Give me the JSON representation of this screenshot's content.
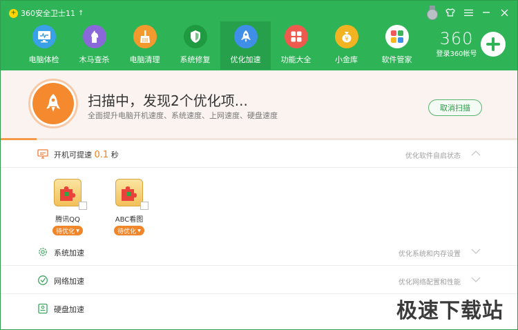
{
  "app": {
    "title": "360安全卫士11"
  },
  "nav": [
    {
      "label": "电脑体检",
      "icon": "monitor-icon",
      "color": "#3aa0e8"
    },
    {
      "label": "木马查杀",
      "icon": "horse-icon",
      "color": "#8b68d9"
    },
    {
      "label": "电脑清理",
      "icon": "broom-icon",
      "color": "#f29a2e"
    },
    {
      "label": "系统修复",
      "icon": "shield-icon",
      "color": "#1f9a40"
    },
    {
      "label": "优化加速",
      "icon": "rocket-icon",
      "color": "#3f8fe8",
      "active": true
    },
    {
      "label": "功能大全",
      "icon": "grid-icon",
      "color": "#ee5a4e"
    },
    {
      "label": "小金库",
      "icon": "coin-icon",
      "color": "#f1b321"
    },
    {
      "label": "软件管家",
      "icon": "apps-icon",
      "color": "#ffffff"
    }
  ],
  "brand": {
    "logo": "360",
    "login": "登录360帐号"
  },
  "scan": {
    "title": "扫描中，发现2个优化项...",
    "subtitle": "全面提升电脑开机速度、系统速度、上网速度、硬盘速度",
    "cancel": "取消扫描",
    "progress": 0.07
  },
  "sections": {
    "boot": {
      "label": "开机可提速",
      "value": "0.1",
      "unit": "秒",
      "right": "优化软件自启状态"
    },
    "system": {
      "label": "系统加速",
      "right": "优化系统和内存设置"
    },
    "network": {
      "label": "网络加速",
      "right": "优化网络配置和性能"
    },
    "disk": {
      "label": "硬盘加速"
    }
  },
  "apps": [
    {
      "name": "腾讯QQ",
      "badge": "待优化"
    },
    {
      "name": "ABC看图",
      "badge": "待优化"
    }
  ],
  "colors": {
    "header": "#2eb457",
    "accent": "#f0852a",
    "banner": "#fbf3ef"
  },
  "watermark": "极速下载站"
}
